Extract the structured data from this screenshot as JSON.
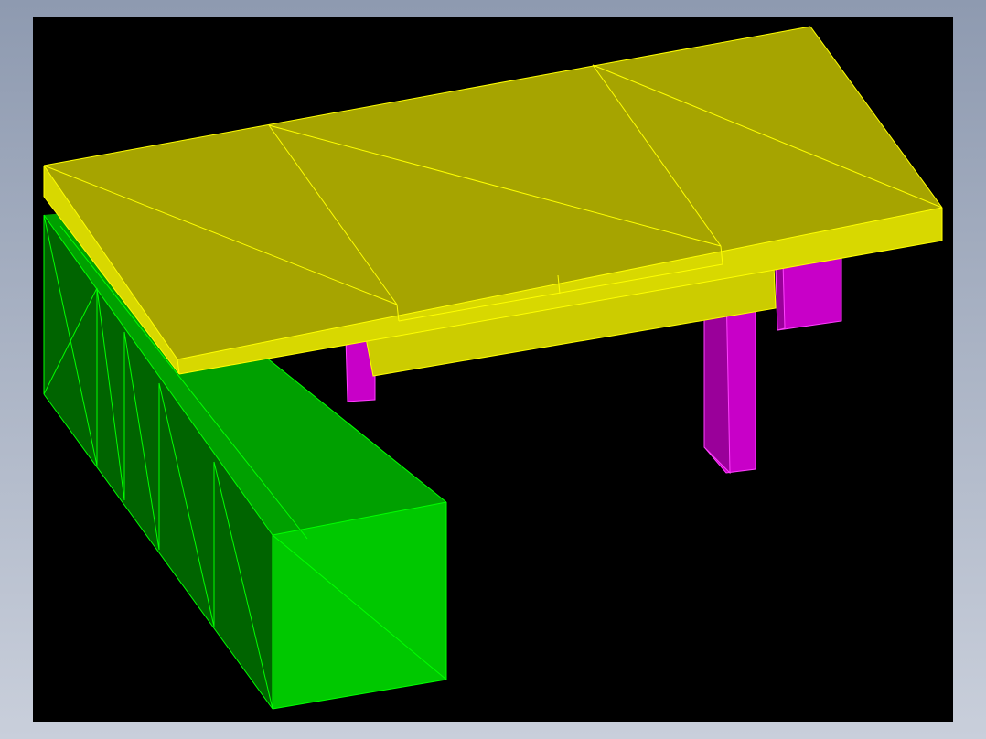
{
  "scene": {
    "view": "3d-wireframe-shaded-model",
    "model": "l-shaped-desk",
    "parts": [
      {
        "name": "desktop",
        "color": "yellow"
      },
      {
        "name": "cabinet",
        "color": "green"
      },
      {
        "name": "legs",
        "color": "magenta"
      }
    ]
  },
  "colors": {
    "frame_gradient_top": "#8e9ab0",
    "frame_gradient_bottom": "#c9cfdb",
    "viewport_bg": "#000000",
    "desktop_top": "#a6a400",
    "desktop_front": "#d8d800",
    "desktop_edge": "#ffff00",
    "desktop_under": "#cccc00",
    "cabinet_top": "#00a000",
    "cabinet_front": "#006400",
    "cabinet_end": "#00c800",
    "cabinet_edge": "#00ff00",
    "leg_fill": "#c800c8",
    "leg_shade": "#9a009a",
    "leg_edge": "#ff40ff"
  }
}
